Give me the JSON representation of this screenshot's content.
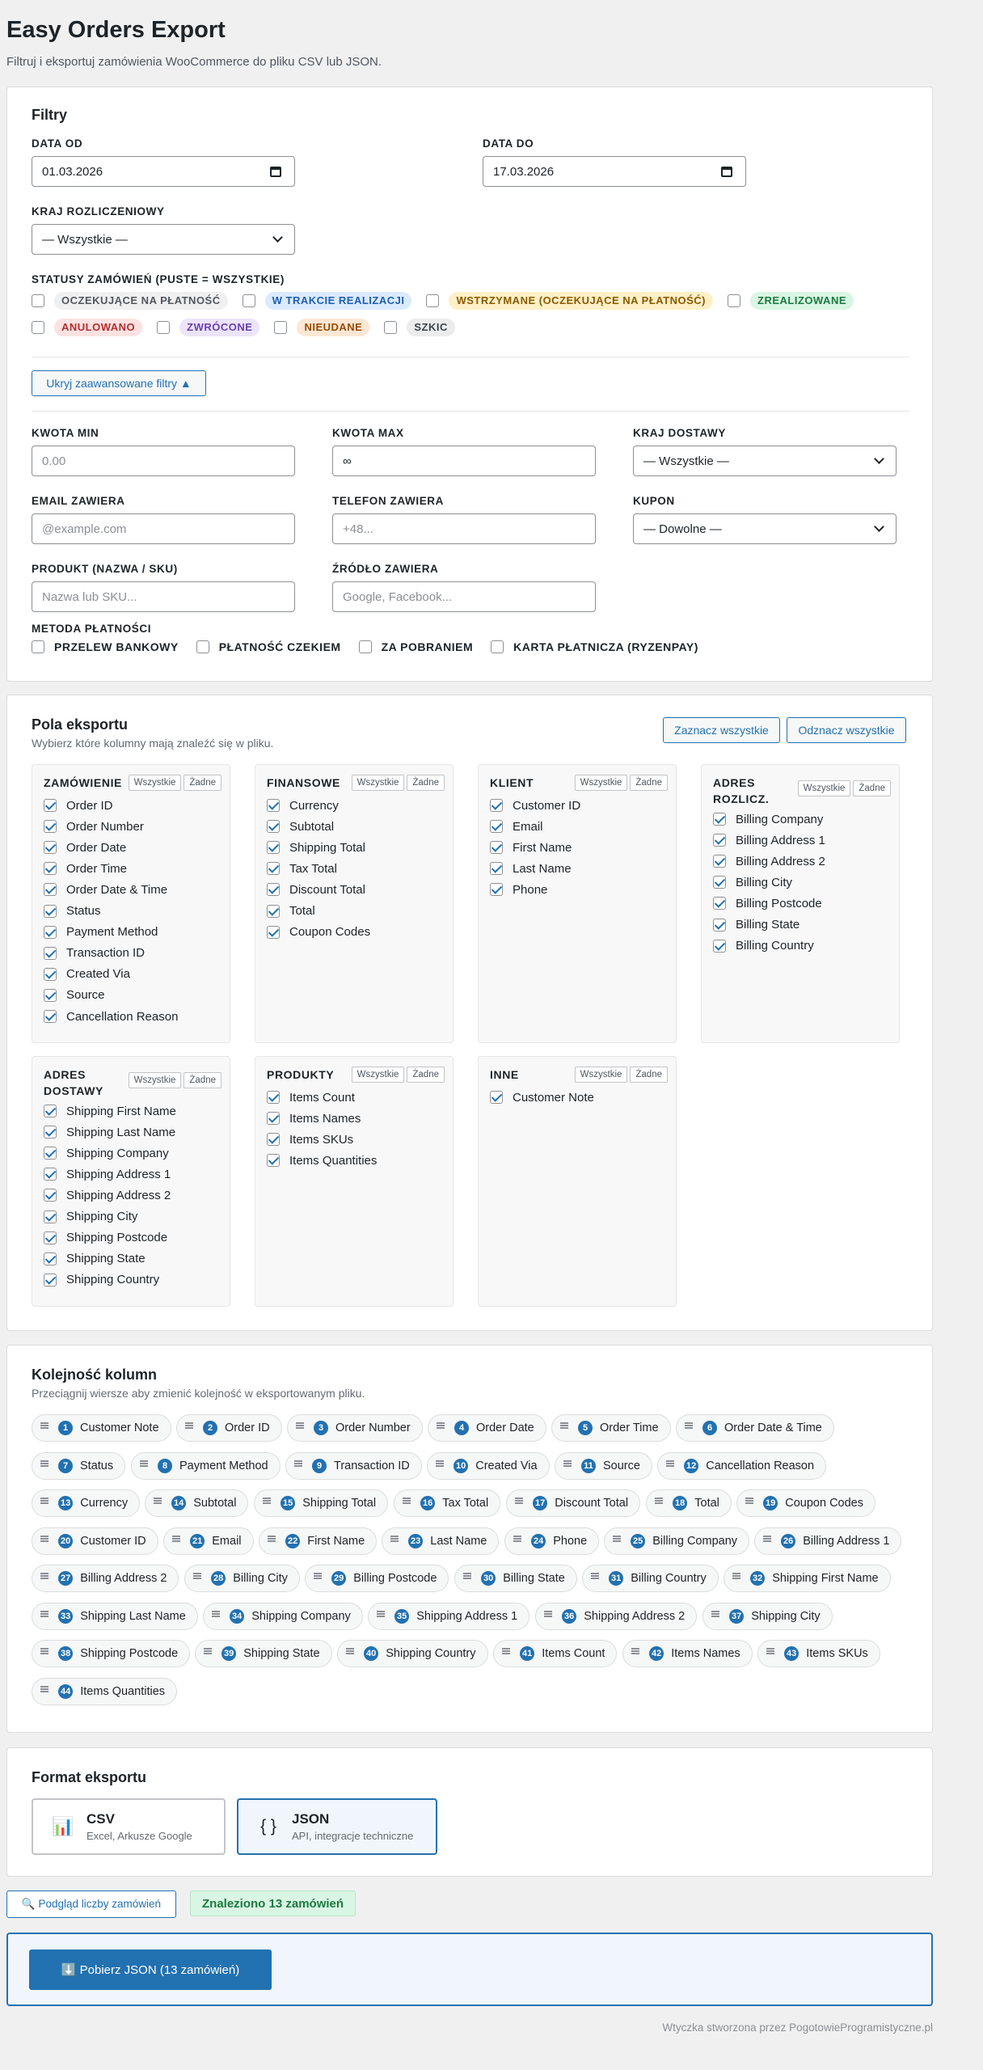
{
  "header": {
    "title": "Easy Orders Export",
    "subtitle": "Filtruj i eksportuj zamówienia WooCommerce do pliku CSV lub JSON."
  },
  "filters": {
    "title": "Filtry",
    "date_from_label": "DATA OD",
    "date_from_value": "01.03.2026",
    "date_to_label": "DATA DO",
    "date_to_value": "17.03.2026",
    "billing_country_label": "KRAJ ROZLICZENIOWY",
    "billing_country_value": "— Wszystkie —",
    "statuses_label": "STATUSY ZAMÓWIEŃ (PUSTE = WSZYSTKIE)",
    "statuses": [
      {
        "label": "OCZEKUJĄCE NA PŁATNOŚĆ",
        "bg": "#f0f0f1",
        "fg": "#50575e"
      },
      {
        "label": "W TRAKCIE REALIZACJI",
        "bg": "#dbeafe",
        "fg": "#1e5fae"
      },
      {
        "label": "WSTRZYMANE (OCZEKUJĄCE NA PŁATNOŚĆ)",
        "bg": "#fdf0c7",
        "fg": "#8a5a00"
      },
      {
        "label": "ZREALIZOWANE",
        "bg": "#d9f5e3",
        "fg": "#1b7a3f"
      },
      {
        "label": "ANULOWANO",
        "bg": "#fde2e1",
        "fg": "#b32d2e"
      },
      {
        "label": "ZWRÓCONE",
        "bg": "#ece4fb",
        "fg": "#6a3fb2"
      },
      {
        "label": "NIEUDANE",
        "bg": "#fde7d4",
        "fg": "#9a4a00"
      },
      {
        "label": "SZKIC",
        "bg": "#ececec",
        "fg": "#3c434a"
      }
    ],
    "toggle_advanced": "Ukryj zaawansowane filtry ▲",
    "amount_min_label": "KWOTA MIN",
    "amount_min_placeholder": "0.00",
    "amount_max_label": "KWOTA MAX",
    "amount_max_placeholder": "∞",
    "shipping_country_label": "KRAJ DOSTAWY",
    "shipping_country_value": "— Wszystkie —",
    "email_label": "EMAIL ZAWIERA",
    "email_placeholder": "@example.com",
    "phone_label": "TELEFON ZAWIERA",
    "phone_placeholder": "+48...",
    "coupon_label": "KUPON",
    "coupon_value": "— Dowolne —",
    "product_label": "PRODUKT (NAZWA / SKU)",
    "product_placeholder": "Nazwa lub SKU...",
    "source_label": "ŹRÓDŁO ZAWIERA",
    "source_placeholder": "Google, Facebook...",
    "payment_label": "METODA PŁATNOŚCI",
    "payments": [
      "PRZELEW BANKOWY",
      "PŁATNOŚĆ CZEKIEM",
      "ZA POBRANIEM",
      "KARTA PŁATNICZA (RYZENPAY)"
    ]
  },
  "export_fields": {
    "title": "Pola eksportu",
    "subtitle": "Wybierz które kolumny mają znaleźć się w pliku.",
    "select_all": "Zaznacz wszystkie",
    "deselect_all": "Odznacz wszystkie",
    "all_label": "Wszystkie",
    "none_label": "Żadne",
    "groups": [
      {
        "title": "ZAMÓWIENIE",
        "fields": [
          "Order ID",
          "Order Number",
          "Order Date",
          "Order Time",
          "Order Date & Time",
          "Status",
          "Payment Method",
          "Transaction ID",
          "Created Via",
          "Source",
          "Cancellation Reason"
        ]
      },
      {
        "title": "FINANSOWE",
        "fields": [
          "Currency",
          "Subtotal",
          "Shipping Total",
          "Tax Total",
          "Discount Total",
          "Total",
          "Coupon Codes"
        ]
      },
      {
        "title": "KLIENT",
        "fields": [
          "Customer ID",
          "Email",
          "First Name",
          "Last Name",
          "Phone"
        ]
      },
      {
        "title": "ADRES ROZLICZ.",
        "fields": [
          "Billing Company",
          "Billing Address 1",
          "Billing Address 2",
          "Billing City",
          "Billing Postcode",
          "Billing State",
          "Billing Country"
        ]
      },
      {
        "title": "ADRES DOSTAWY",
        "fields": [
          "Shipping First Name",
          "Shipping Last Name",
          "Shipping Company",
          "Shipping Address 1",
          "Shipping Address 2",
          "Shipping City",
          "Shipping Postcode",
          "Shipping State",
          "Shipping Country"
        ]
      },
      {
        "title": "PRODUKTY",
        "fields": [
          "Items Count",
          "Items Names",
          "Items SKUs",
          "Items Quantities"
        ]
      },
      {
        "title": "INNE",
        "fields": [
          "Customer Note"
        ]
      }
    ]
  },
  "column_order": {
    "title": "Kolejność kolumn",
    "subtitle": "Przeciągnij wiersze aby zmienić kolejność w eksportowanym pliku.",
    "items": [
      {
        "n": "1",
        "label": "Customer Note"
      },
      {
        "n": "2",
        "label": "Order ID"
      },
      {
        "n": "3",
        "label": "Order Number"
      },
      {
        "n": "4",
        "label": "Order Date"
      },
      {
        "n": "5",
        "label": "Order Time"
      },
      {
        "n": "6",
        "label": "Order Date & Time"
      },
      {
        "n": "7",
        "label": "Status"
      },
      {
        "n": "8",
        "label": "Payment Method"
      },
      {
        "n": "9",
        "label": "Transaction ID"
      },
      {
        "n": "10",
        "label": "Created Via"
      },
      {
        "n": "11",
        "label": "Source"
      },
      {
        "n": "12",
        "label": "Cancellation Reason"
      },
      {
        "n": "13",
        "label": "Currency"
      },
      {
        "n": "14",
        "label": "Subtotal"
      },
      {
        "n": "15",
        "label": "Shipping Total"
      },
      {
        "n": "16",
        "label": "Tax Total"
      },
      {
        "n": "17",
        "label": "Discount Total"
      },
      {
        "n": "18",
        "label": "Total"
      },
      {
        "n": "19",
        "label": "Coupon Codes"
      },
      {
        "n": "20",
        "label": "Customer ID"
      },
      {
        "n": "21",
        "label": "Email"
      },
      {
        "n": "22",
        "label": "First Name"
      },
      {
        "n": "23",
        "label": "Last Name"
      },
      {
        "n": "24",
        "label": "Phone"
      },
      {
        "n": "25",
        "label": "Billing Company"
      },
      {
        "n": "26",
        "label": "Billing Address 1"
      },
      {
        "n": "27",
        "label": "Billing Address 2"
      },
      {
        "n": "28",
        "label": "Billing City"
      },
      {
        "n": "29",
        "label": "Billing Postcode"
      },
      {
        "n": "30",
        "label": "Billing State"
      },
      {
        "n": "31",
        "label": "Billing Country"
      },
      {
        "n": "32",
        "label": "Shipping First Name"
      },
      {
        "n": "33",
        "label": "Shipping Last Name"
      },
      {
        "n": "34",
        "label": "Shipping Company"
      },
      {
        "n": "35",
        "label": "Shipping Address 1"
      },
      {
        "n": "36",
        "label": "Shipping Address 2"
      },
      {
        "n": "37",
        "label": "Shipping City"
      },
      {
        "n": "38",
        "label": "Shipping Postcode"
      },
      {
        "n": "39",
        "label": "Shipping State"
      },
      {
        "n": "40",
        "label": "Shipping Country"
      },
      {
        "n": "41",
        "label": "Items Count"
      },
      {
        "n": "42",
        "label": "Items Names"
      },
      {
        "n": "43",
        "label": "Items SKUs"
      },
      {
        "n": "44",
        "label": "Items Quantities"
      }
    ]
  },
  "format": {
    "title": "Format eksportu",
    "options": [
      {
        "name": "CSV",
        "desc": "Excel, Arkusze Google",
        "icon": "chart-icon",
        "glyph": "📊",
        "selected": false
      },
      {
        "name": "JSON",
        "desc": "API, integracje techniczne",
        "icon": "braces-icon",
        "glyph": "{ }",
        "selected": true
      }
    ]
  },
  "preview": {
    "button": "🔍 Podgląd liczby zamówień",
    "result": "Znaleziono 13 zamówień"
  },
  "download": {
    "button": "⬇️ Pobierz JSON (13 zamówień)"
  },
  "footer": "Wtyczka stworzona przez PogotowieProgramistyczne.pl",
  "colors": {
    "accent": "#2271b1",
    "success_bg": "#d9f5e3",
    "success_fg": "#1b7a3f",
    "primary_button": "#2271b1"
  }
}
